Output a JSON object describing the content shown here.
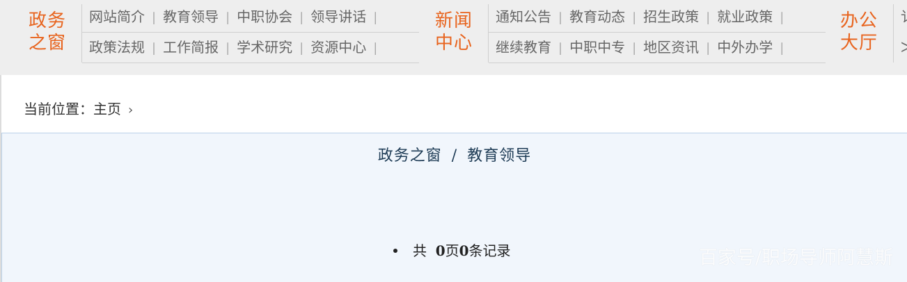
{
  "nav": {
    "groups": [
      {
        "title_line1": "政务",
        "title_line2": "之窗",
        "row1": [
          "网站简介",
          "教育领导",
          "中职协会",
          "领导讲话"
        ],
        "row2": [
          "政策法规",
          "工作简报",
          "学术研究",
          "资源中心"
        ]
      },
      {
        "title_line1": "新闻",
        "title_line2": "中心",
        "row1": [
          "通知公告",
          "教育动态",
          "招生政策",
          "就业政策"
        ],
        "row2": [
          "继续教育",
          "中职中专",
          "地区资讯",
          "中外办学"
        ]
      },
      {
        "title_line1": "办公",
        "title_line2": "大厅",
        "row1": [
          "讠"
        ],
        "row2": [
          "ᐳ"
        ]
      }
    ],
    "separator": "|"
  },
  "breadcrumb": {
    "label": "当前位置：",
    "home": "主页",
    "chevron": "›"
  },
  "content": {
    "title_part1": "政务之窗",
    "title_slash": "/",
    "title_part2": "教育领导",
    "pager": {
      "prefix": "共",
      "pages": "0",
      "pages_unit": "页",
      "records": "0",
      "records_unit": "条记录"
    }
  },
  "watermark": "百家号/职场导师阿慧斯",
  "colors": {
    "accent": "#e8641e",
    "nav_bg": "#eeeeee",
    "panel_bg": "#f1f6fc",
    "title_color": "#1d3b55"
  }
}
